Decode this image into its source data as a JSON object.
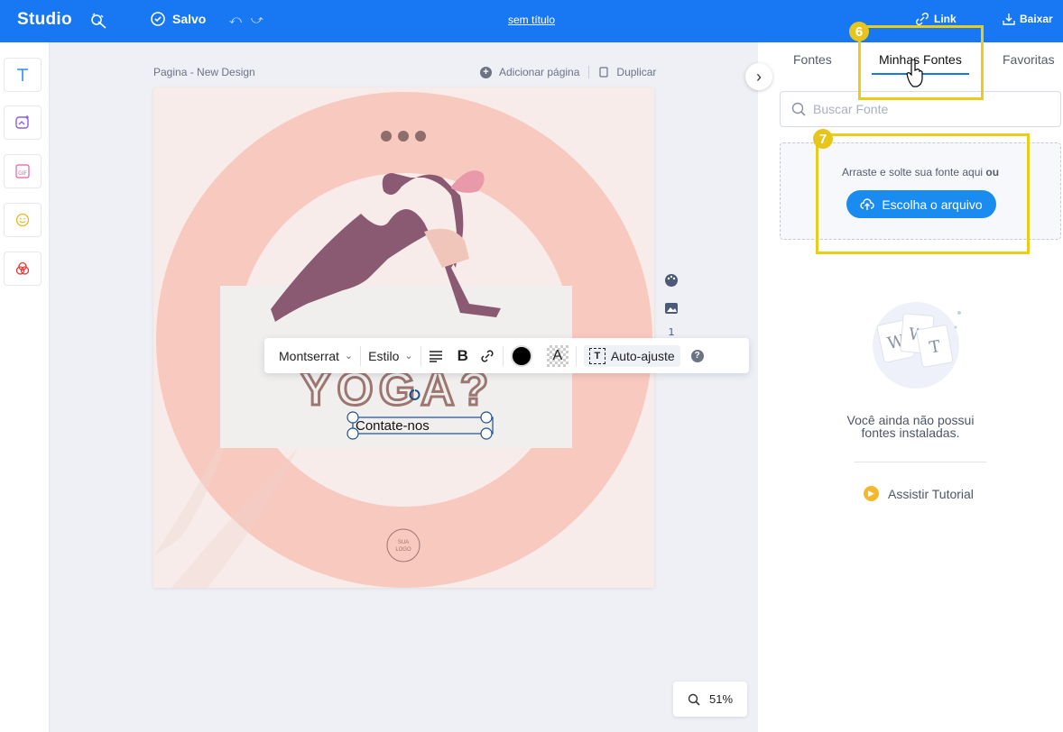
{
  "app": {
    "brand": "Studio",
    "saved_label": "Salvo",
    "doc_title": "sem título",
    "link_label": "Link",
    "download_label": "Baixar"
  },
  "left_tools": [
    {
      "name": "text-tool",
      "icon": "text-icon"
    },
    {
      "name": "image-tool",
      "icon": "image-sparkle-icon"
    },
    {
      "name": "gif-tool",
      "icon": "gif-icon"
    },
    {
      "name": "emoji-tool",
      "icon": "smiley-icon"
    },
    {
      "name": "color-tool",
      "icon": "overlapping-circles-icon"
    }
  ],
  "canvas": {
    "page_label": "Pagina - New Design",
    "add_page": "Adicionar página",
    "duplicate": "Duplicar",
    "design": {
      "heading": "YOGA?",
      "cta": "Contate-nos",
      "logo_line1": "SUA",
      "logo_line2": "LOGO",
      "side_number": "1"
    },
    "toolbar": {
      "font": "Montserrat",
      "style": "Estilo",
      "auto_fit": "Auto-ajuste",
      "help": "?"
    },
    "zoom": "51%"
  },
  "right_panel": {
    "tabs": [
      "Fontes",
      "Minhas Fontes",
      "Favoritas"
    ],
    "active_tab": "Minhas Fontes",
    "search_placeholder": "Buscar Fonte",
    "drop_text": "Arraste e solte sua fonte aqui",
    "drop_or": "ou",
    "choose_file": "Escolha o arquivo",
    "empty_line1": "Você ainda não possui",
    "empty_line2": "fontes instaladas.",
    "tutorial": "Assistir Tutorial"
  },
  "annotations": {
    "badge_6": "6",
    "badge_7": "7"
  },
  "colors": {
    "topbar": "#1877f2",
    "accent": "#1a8cf0",
    "highlight": "#e8cd1a",
    "design_bg": "#f7ece9",
    "ring": "#f8c9bf"
  }
}
